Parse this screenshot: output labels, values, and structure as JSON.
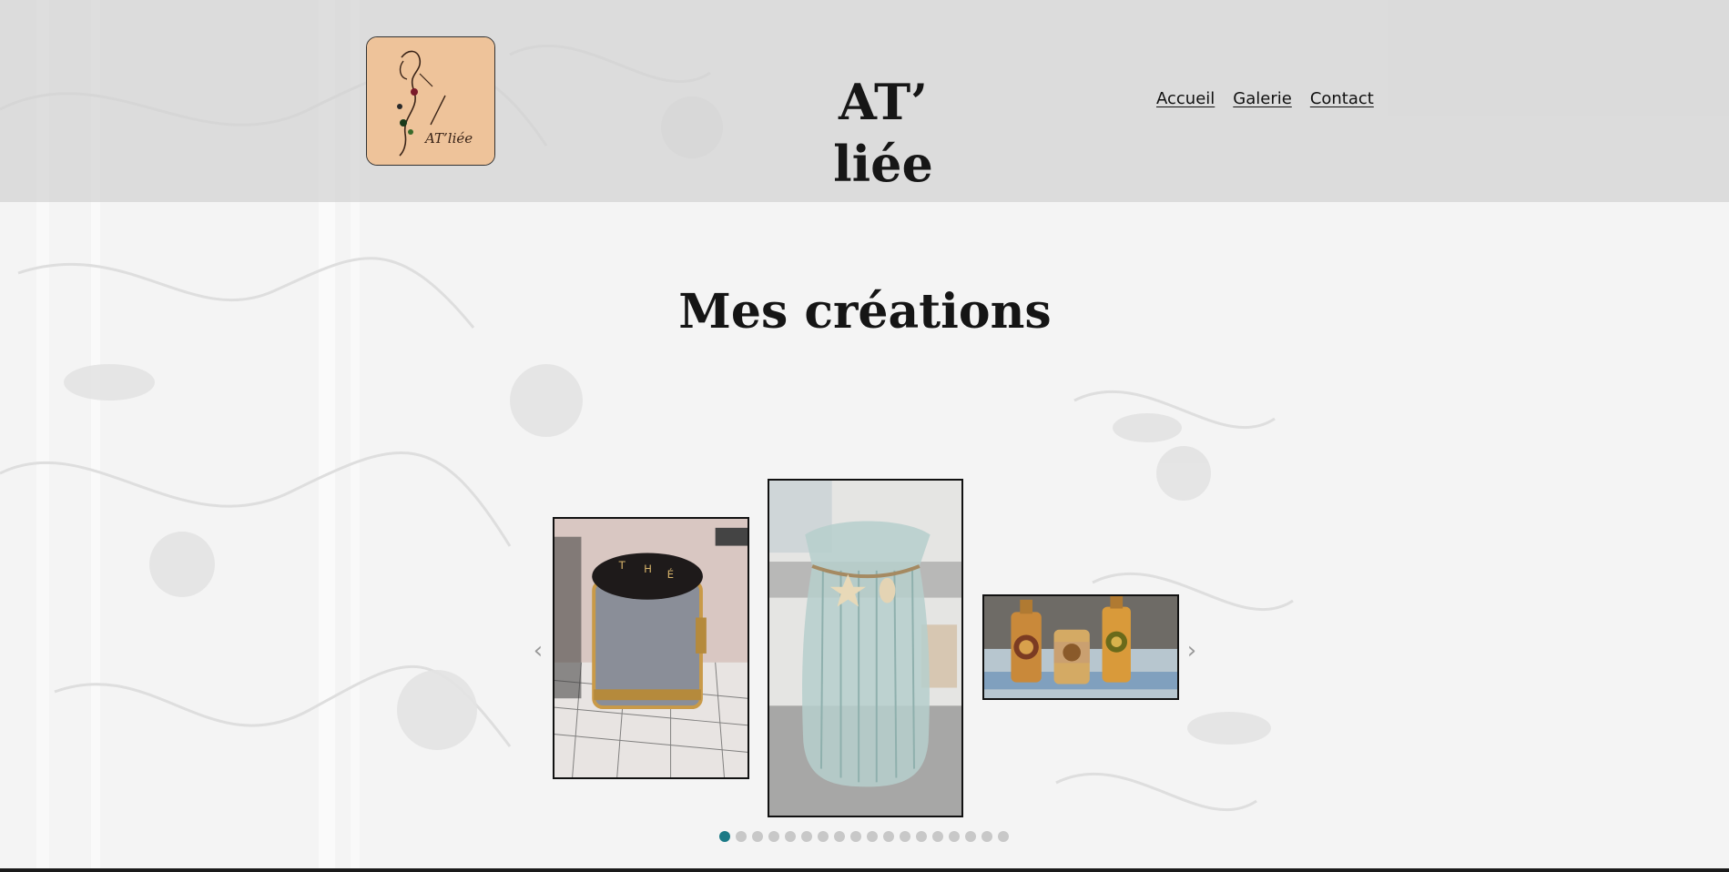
{
  "header": {
    "site_title": "AT’ liée",
    "logo_text": "AT’liée",
    "nav": [
      {
        "label": "Accueil"
      },
      {
        "label": "Galerie"
      },
      {
        "label": "Contact"
      }
    ]
  },
  "main": {
    "heading": "Mes créations",
    "carousel": {
      "prev_icon": "chevron-left-icon",
      "next_icon": "chevron-right-icon",
      "prev_glyph": "‹",
      "next_glyph": "›",
      "slides": [
        {
          "image": "tea-canister-photo"
        },
        {
          "image": "glass-vase-photo"
        },
        {
          "image": "decorated-bottles-photo"
        }
      ],
      "dots_count": 18,
      "active_dot": 0
    }
  },
  "colors": {
    "accent": "#1b7a86",
    "header_bg": "#d9d9d9",
    "logo_bg": "#eec39a"
  }
}
